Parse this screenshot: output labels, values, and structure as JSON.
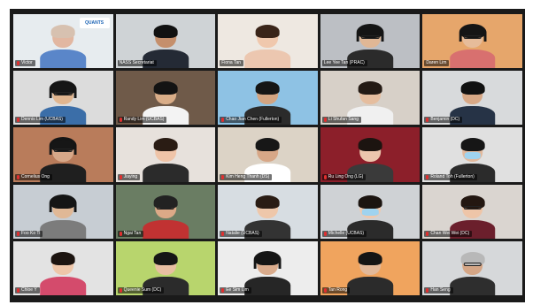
{
  "meeting": {
    "layout": "gallery",
    "columns": 5,
    "rows": 5,
    "active_speaker_index": 0
  },
  "colors": {
    "background": "#1a1a1a",
    "active_border": "#9bd12f",
    "muted_mic": "#e02f2f",
    "nameplate_bg": "rgba(0,0,0,0.55)"
  },
  "participants": [
    {
      "name": "Victor",
      "muted": true,
      "bg": "#e7ecef",
      "skin": "#e2b7a1",
      "hair": "#d7c1b0",
      "shirt": "#5a86c9",
      "logo": "QUANTS",
      "glasses": false,
      "headset": false,
      "mask": false
    },
    {
      "name": "NASS Secretariat",
      "muted": false,
      "bg": "#cfd3d6",
      "skin": "#c58f6c",
      "hair": "#111111",
      "shirt": "#242a35",
      "logo": "",
      "glasses": false,
      "headset": false,
      "mask": false
    },
    {
      "name": "Fiona Tan",
      "muted": false,
      "bg": "#eee8e1",
      "skin": "#f0c8ad",
      "hair": "#3a2418",
      "shirt": "#ecc7b0",
      "logo": "",
      "glasses": false,
      "headset": false,
      "mask": false
    },
    {
      "name": "Lee Yee Tan (PRAC)",
      "muted": false,
      "bg": "#bcbfc4",
      "skin": "#e0b795",
      "hair": "#141414",
      "shirt": "#2b2b2b",
      "logo": "",
      "glasses": true,
      "headset": true,
      "mask": false
    },
    {
      "name": "Daren Lim",
      "muted": false,
      "bg": "#e6a66b",
      "skin": "#e6bc9a",
      "hair": "#151515",
      "shirt": "#d8706f",
      "logo": "",
      "glasses": true,
      "headset": true,
      "mask": false
    },
    {
      "name": "Dennis Lim (UCBAS)",
      "muted": true,
      "bg": "#dcdcdc",
      "skin": "#e0b58f",
      "hair": "#161616",
      "shirt": "#3b6ea8",
      "logo": "",
      "glasses": true,
      "headset": true,
      "mask": false
    },
    {
      "name": "Randy Lim (UCBAS)",
      "muted": true,
      "bg": "#6f5a49",
      "skin": "#d9ad88",
      "hair": "#131313",
      "shirt": "#f3f3f3",
      "logo": "",
      "glasses": false,
      "headset": false,
      "mask": false
    },
    {
      "name": "Chao Jian Chen (Fullerton)",
      "muted": true,
      "bg": "#8ec2e4",
      "skin": "#d3a481",
      "hair": "#151515",
      "shirt": "#2b2b2b",
      "logo": "",
      "glasses": false,
      "headset": false,
      "mask": false
    },
    {
      "name": "Li Shufan Sang",
      "muted": true,
      "bg": "#d7d0c8",
      "skin": "#e5bd9e",
      "hair": "#241a14",
      "shirt": "#f0f0f0",
      "logo": "",
      "glasses": false,
      "headset": false,
      "mask": false
    },
    {
      "name": "Benjamin (DC)",
      "muted": true,
      "bg": "#d8dadc",
      "skin": "#d8a886",
      "hair": "#111111",
      "shirt": "#263346",
      "logo": "",
      "glasses": false,
      "headset": false,
      "mask": false
    },
    {
      "name": "Cornelius Ong",
      "muted": true,
      "bg": "#b97c5b",
      "skin": "#d7a889",
      "hair": "#161616",
      "shirt": "#1f1f1f",
      "logo": "",
      "glasses": true,
      "headset": true,
      "mask": false
    },
    {
      "name": "Jiaying",
      "muted": true,
      "bg": "#e7e1dc",
      "skin": "#efc4a8",
      "hair": "#2a1c14",
      "shirt": "#2b2b2b",
      "logo": "",
      "glasses": false,
      "headset": false,
      "mask": false
    },
    {
      "name": "Kim Heng Thanh (DS)",
      "muted": true,
      "bg": "#dcd3c6",
      "skin": "#d7a787",
      "hair": "#171717",
      "shirt": "#ffffff",
      "logo": "",
      "glasses": false,
      "headset": false,
      "mask": false
    },
    {
      "name": "Ru Ling Ong (LG)",
      "muted": true,
      "bg": "#8c1f2a",
      "skin": "#ecc6ad",
      "hair": "#1c1410",
      "shirt": "#3a3a3a",
      "logo": "",
      "glasses": false,
      "headset": false,
      "mask": false
    },
    {
      "name": "Roland Toh (Fullerton)",
      "muted": true,
      "bg": "#e0e0e0",
      "skin": "#e2b99d",
      "hair": "#161616",
      "shirt": "#2b2b2b",
      "logo": "",
      "glasses": false,
      "headset": false,
      "mask": true
    },
    {
      "name": "Foo Ko Ti",
      "muted": true,
      "bg": "#c7cdd3",
      "skin": "#e0b896",
      "hair": "#151515",
      "shirt": "#7c7c7c",
      "logo": "",
      "glasses": false,
      "headset": true,
      "mask": false
    },
    {
      "name": "Ngai Tan",
      "muted": true,
      "bg": "#6a7d63",
      "skin": "#dca987",
      "hair": "#222222",
      "shirt": "#c13232",
      "logo": "",
      "glasses": true,
      "headset": false,
      "mask": false
    },
    {
      "name": "Natalie (UCBAS)",
      "muted": true,
      "bg": "#d7dde2",
      "skin": "#eec7aa",
      "hair": "#2a1c14",
      "shirt": "#333333",
      "logo": "",
      "glasses": false,
      "headset": false,
      "mask": false
    },
    {
      "name": "Michelle (UCBAS)",
      "muted": true,
      "bg": "#cfd2d5",
      "skin": "#efc9ae",
      "hair": "#1b1410",
      "shirt": "#2b2b2b",
      "logo": "",
      "glasses": false,
      "headset": false,
      "mask": true
    },
    {
      "name": "Chan Wei Wei (DC)",
      "muted": true,
      "bg": "#dad5d0",
      "skin": "#eec5a8",
      "hair": "#231711",
      "shirt": "#6b1f2c",
      "logo": "",
      "glasses": true,
      "headset": false,
      "mask": false
    },
    {
      "name": "Chloe Y",
      "muted": true,
      "bg": "#e3e3e3",
      "skin": "#eec6a9",
      "hair": "#1c1410",
      "shirt": "#d44b6c",
      "logo": "",
      "glasses": false,
      "headset": false,
      "mask": false
    },
    {
      "name": "Queenie Sum (DC)",
      "muted": true,
      "bg": "#b8d56d",
      "skin": "#e8bfa2",
      "hair": "#161616",
      "shirt": "#2b2b2b",
      "logo": "",
      "glasses": false,
      "headset": false,
      "mask": false
    },
    {
      "name": "Ee Sim Lim",
      "muted": true,
      "bg": "#ededed",
      "skin": "#d9ab8c",
      "hair": "#141414",
      "shirt": "#262626",
      "logo": "",
      "glasses": false,
      "headset": true,
      "mask": false
    },
    {
      "name": "Tan Rong",
      "muted": true,
      "bg": "#f0a45e",
      "skin": "#e2b99a",
      "hair": "#151515",
      "shirt": "#2b2b2b",
      "logo": "",
      "glasses": false,
      "headset": false,
      "mask": false
    },
    {
      "name": "Han Seng",
      "muted": true,
      "bg": "#d6d8da",
      "skin": "#d5a686",
      "hair": "#b8b8b8",
      "shirt": "#2e2e2e",
      "logo": "",
      "glasses": true,
      "headset": false,
      "mask": false
    }
  ]
}
